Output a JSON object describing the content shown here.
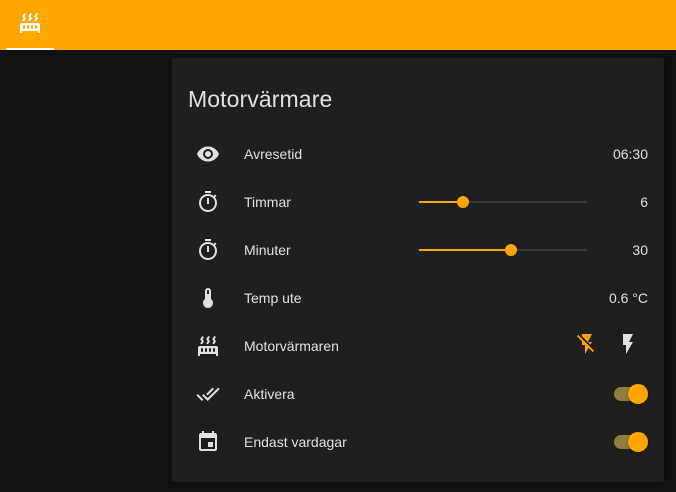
{
  "colors": {
    "accent": "#ffa600",
    "background": "#111111",
    "card": "#1f1f1f",
    "text": "#e1e1e1",
    "icon": "#e1e1e1",
    "toggle_track": "#8c7f3f"
  },
  "topbar": {
    "tab_icon": "radiator-icon"
  },
  "card": {
    "title": "Motorvärmare",
    "rows": [
      {
        "icon": "eye-icon",
        "label": "Avresetid",
        "value": "06:30"
      },
      {
        "icon": "timer-icon",
        "label": "Timmar",
        "value": "6",
        "slider_fraction": 0.26
      },
      {
        "icon": "timer-icon",
        "label": "Minuter",
        "value": "30",
        "slider_fraction": 0.55
      },
      {
        "icon": "thermometer-icon",
        "label": "Temp ute",
        "value": "0.6 °C"
      },
      {
        "icon": "radiator-icon",
        "label": "Motorvärmaren",
        "off_icon": "flash-off-icon",
        "on_icon": "flash-icon"
      },
      {
        "icon": "check-icon",
        "label": "Aktivera",
        "toggle_on": true
      },
      {
        "icon": "calendar-icon",
        "label": "Endast vardagar",
        "toggle_on": true
      }
    ]
  }
}
